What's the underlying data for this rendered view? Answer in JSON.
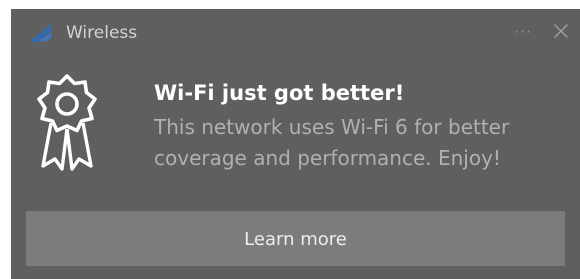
{
  "notification": {
    "app_name": "Wireless",
    "app_icon": "wireless-signal-icon",
    "more_label": "···",
    "close_icon": "close-icon",
    "badge_icon": "award-ribbon-icon",
    "title": "Wi-Fi just got better!",
    "body": "This network uses Wi-Fi 6 for better coverage and performance. Enjoy!",
    "action_label": "Learn more"
  },
  "colors": {
    "toast_bg": "#5f5f5f",
    "button_bg": "#7c7c7c",
    "accent": "#2a6cc4",
    "title_text": "#ffffff",
    "body_text": "#b0b0b0"
  }
}
